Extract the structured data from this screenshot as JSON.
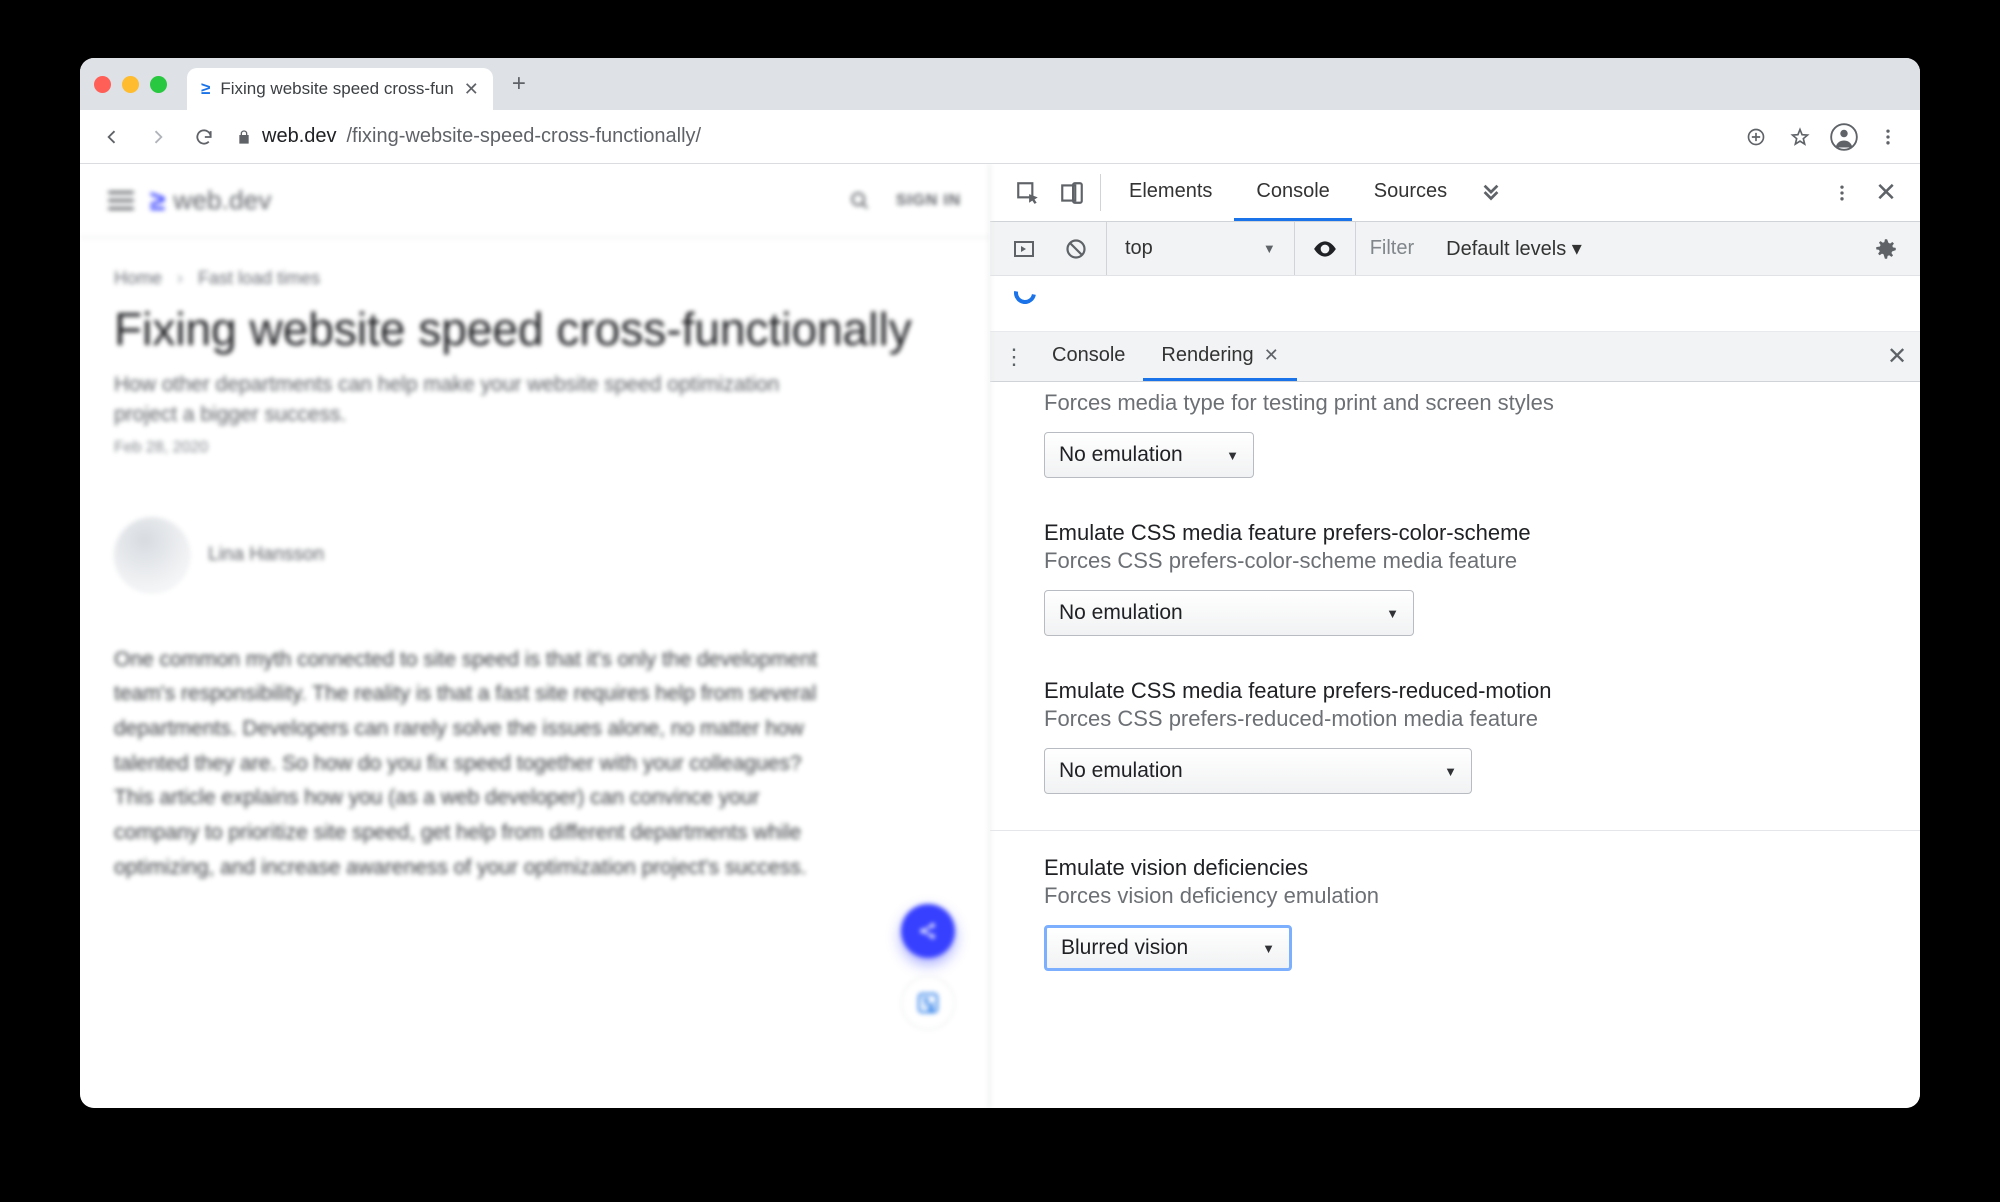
{
  "browser": {
    "tab_title": "Fixing website speed cross-fun",
    "url_host": "web.dev",
    "url_path": "/fixing-website-speed-cross-functionally/"
  },
  "page": {
    "brand": "web.dev",
    "signin": "SIGN IN",
    "crumb_home": "Home",
    "crumb_section": "Fast load times",
    "title": "Fixing website speed cross-functionally",
    "subtitle": "How other departments can help make your website speed optimization project a bigger success.",
    "date": "Feb 28, 2020",
    "author": "Lina Hansson",
    "body": "One common myth connected to site speed is that it's only the development team's responsibility. The reality is that a fast site requires help from several departments. Developers can rarely solve the issues alone, no matter how talented they are. So how do you fix speed together with your colleagues? This article explains how you (as a web developer) can convince your company to prioritize site speed, get help from different departments while optimizing, and increase awareness of your optimization project's success."
  },
  "devtools": {
    "tabs": {
      "elements": "Elements",
      "console": "Console",
      "sources": "Sources"
    },
    "console": {
      "context": "top",
      "filter_placeholder": "Filter",
      "levels": "Default levels ▾"
    },
    "drawer": {
      "console": "Console",
      "rendering": "Rendering"
    },
    "rendering": {
      "media_desc": "Forces media type for testing print and screen styles",
      "media_value": "No emulation",
      "pcs_title": "Emulate CSS media feature prefers-color-scheme",
      "pcs_desc": "Forces CSS prefers-color-scheme media feature",
      "pcs_value": "No emulation",
      "prm_title": "Emulate CSS media feature prefers-reduced-motion",
      "prm_desc": "Forces CSS prefers-reduced-motion media feature",
      "prm_value": "No emulation",
      "vision_title": "Emulate vision deficiencies",
      "vision_desc": "Forces vision deficiency emulation",
      "vision_value": "Blurred vision"
    }
  }
}
